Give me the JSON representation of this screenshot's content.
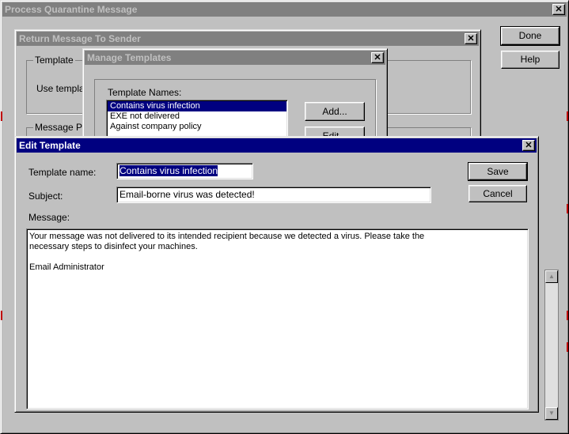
{
  "process_window": {
    "title": "Process Quarantine Message",
    "close_glyph": "✕",
    "done_label": "Done",
    "help_label": "Help",
    "scroll_up_glyph": "▲",
    "scroll_down_glyph": "▼"
  },
  "return_dialog": {
    "title": "Return Message To Sender",
    "close_glyph": "✕",
    "template_group_label": "Template",
    "use_template_label": "Use template",
    "message_props_label": "Message Pro"
  },
  "manage_templates": {
    "title": "Manage Templates",
    "close_glyph": "✕",
    "names_label": "Template Names:",
    "items": [
      "Contains virus infection",
      "EXE not delivered",
      "Against company policy"
    ],
    "add_label": "Add...",
    "edit_label": "Edit..."
  },
  "edit_template": {
    "title": "Edit Template",
    "close_glyph": "✕",
    "name_label": "Template name:",
    "name_value": "Contains virus infection",
    "subject_label": "Subject:",
    "subject_value": "Email-borne virus was detected!",
    "message_label": "Message:",
    "message_line1": "Your message was not delivered to its intended recipient because we detected a virus.  Please take the",
    "message_line2": "necessary steps to disinfect your machines.",
    "message_line3": "",
    "message_line4": "Email Administrator",
    "save_label": "Save",
    "cancel_label": "Cancel"
  }
}
